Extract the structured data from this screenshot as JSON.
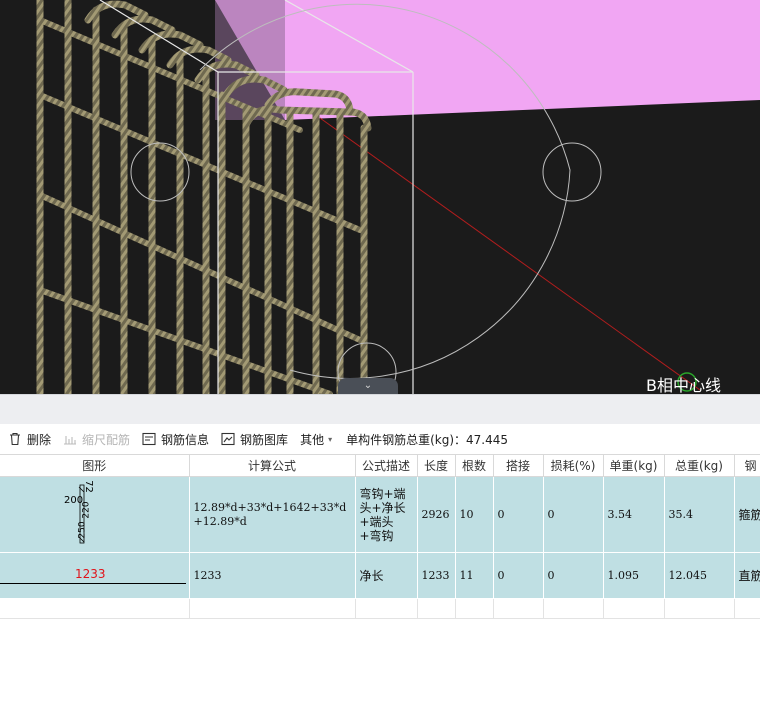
{
  "viewport": {
    "center_line_label": "B相中心线",
    "colors": {
      "background": "#1b1b1b",
      "magenta_plane": "#f1a6f3",
      "rebar": "#8a8160",
      "guide": "#c8c8c8",
      "axis": "#c62020"
    }
  },
  "toolbar": {
    "delete_label": "删除",
    "scale_label": "缩尺配筋",
    "info_label": "钢筋信息",
    "library_label": "钢筋图库",
    "other_label": "其他",
    "total_label": "单构件钢筋总重(kg)：47.445"
  },
  "table": {
    "headers": [
      "图形",
      "计算公式",
      "公式描述",
      "长度",
      "根数",
      "搭接",
      "损耗(%)",
      "单重(kg)",
      "总重(kg)",
      "钢"
    ],
    "rows": [
      {
        "shape_labels": {
          "left": "200",
          "right": "72",
          "mid": "220",
          "bottom": "250"
        },
        "formula": "12.89*d+33*d+1642+33*d+12.89*d",
        "description": "弯钩+端头+净长+端头+弯钩",
        "length": "2926",
        "count": "10",
        "lap": "0",
        "loss": "0",
        "unit_weight": "3.54",
        "total_weight": "35.4",
        "type": "箍筋"
      },
      {
        "shape_text": "1233",
        "formula": "1233",
        "description": "净长",
        "length": "1233",
        "count": "11",
        "lap": "0",
        "loss": "0",
        "unit_weight": "1.095",
        "total_weight": "12.045",
        "type": "直筋"
      }
    ]
  }
}
